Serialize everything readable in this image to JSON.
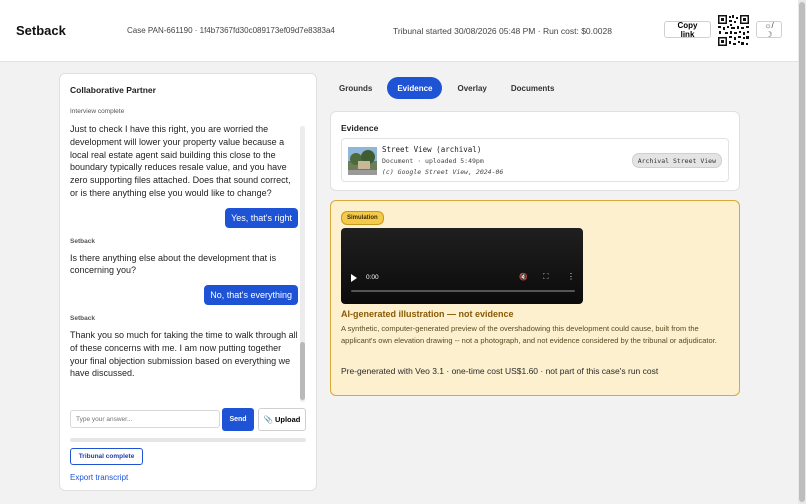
{
  "header": {
    "brand": "Setback",
    "case": "Case PAN-661190 · 1f4b7367fd30c089173ef09d7e8383a4",
    "tribunal": "Tribunal started 30/08/2026 05:48 PM · Run cost: $0.0028",
    "copy_link": "Copy link",
    "theme_toggle": "☼/☽"
  },
  "partner": {
    "title": "Collaborative Partner",
    "status": "Interview complete",
    "messages": {
      "m1_text": "Just to check I have this right, you are worried the development will lower your property value because a local real estate agent said building this close to the boundary typically reduces resale value, and you have zero supporting files attached. Does that sound correct, or is there anything else you would like to change?",
      "r1": "Yes, that's right",
      "m2_sender": "Setback",
      "m2_text": "Is there anything else about the development that is concerning you?",
      "r2": "No, that's everything",
      "m3_sender": "Setback",
      "m3_text": "Thank you so much for taking the time to walk through all of these concerns with me. I am now putting together your final objection submission based on everything we have discussed."
    },
    "answer_placeholder": "Type your answer...",
    "send": "Send",
    "upload": "Upload",
    "tribunal_complete": "Tribunal complete",
    "export": "Export transcript"
  },
  "tabs": [
    "Grounds",
    "Evidence",
    "Overlay",
    "Documents"
  ],
  "active_tab": "Evidence",
  "evidence": {
    "title": "Evidence",
    "item_name": "Street View (archival)",
    "item_meta": "Document · uploaded 5:49pm",
    "item_credit": "(c) Google Street View, 2024-06",
    "item_badge": "Archival Street View"
  },
  "simulation": {
    "badge": "Simulation",
    "video_time": "0:00",
    "heading": "AI-generated illustration — not evidence",
    "description": "A synthetic, computer-generated preview of the overshadowing this development could cause, built from the applicant's own elevation drawing -- not a photograph, and not evidence considered by the tribunal or adjudicator.",
    "cost_note": "Pre-generated with Veo 3.1 · one-time cost US$1.60 · not part of this case's run cost"
  },
  "colors": {
    "accent": "#1f53d6",
    "sim_background": "#fcf0cf",
    "sim_border": "#d9a838",
    "sim_heading": "#8a5a05"
  }
}
